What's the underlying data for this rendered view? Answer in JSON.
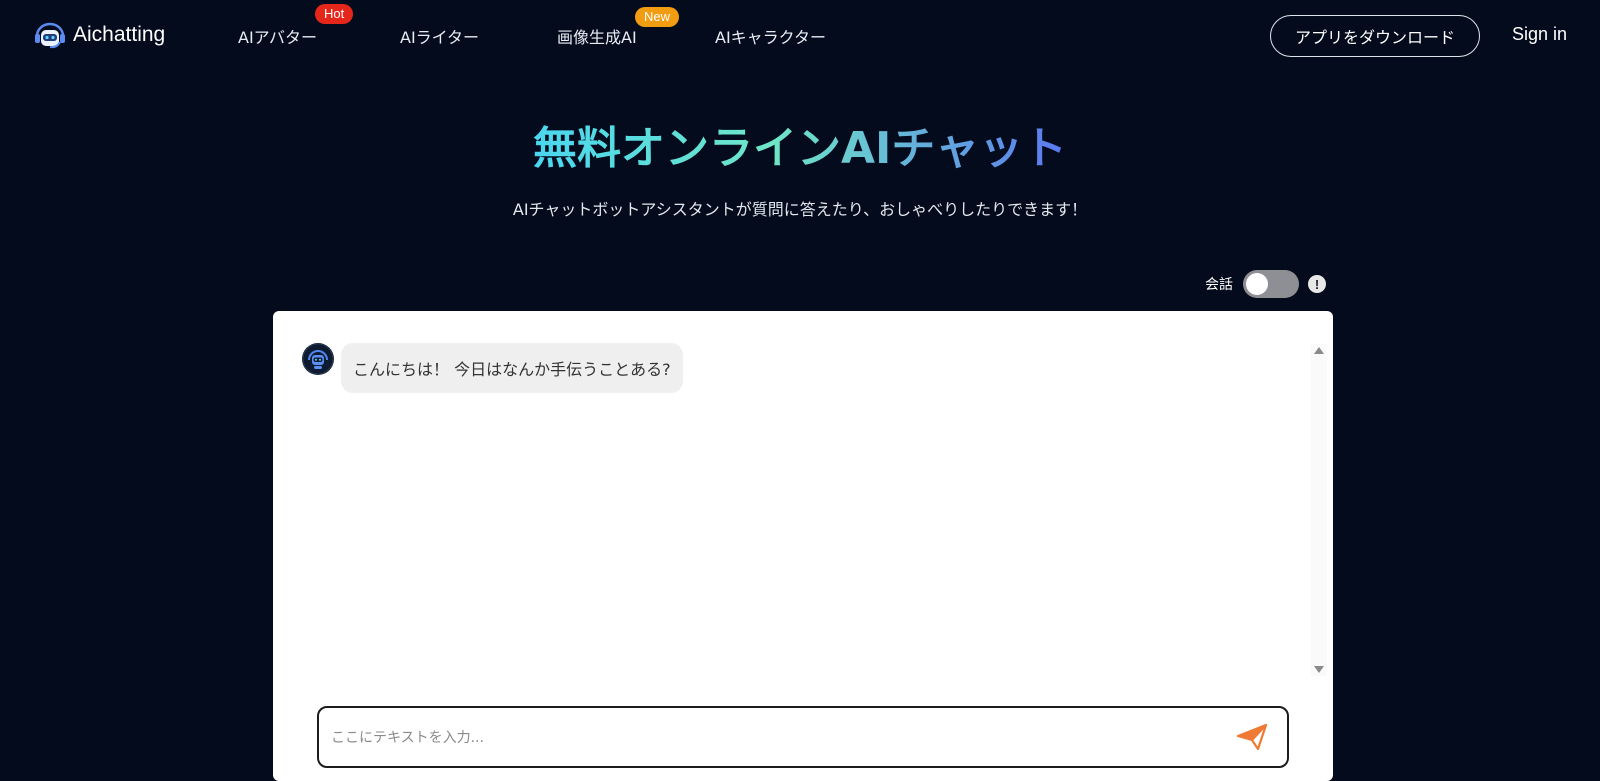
{
  "header": {
    "logo_text": "Aichatting",
    "nav": [
      {
        "label": "AIアバター",
        "badge": "Hot"
      },
      {
        "label": "AIライター"
      },
      {
        "label": "画像生成AI",
        "badge": "New"
      },
      {
        "label": "AIキャラクター"
      }
    ],
    "download_label": "アプリをダウンロード",
    "signin_label": "Sign in"
  },
  "hero": {
    "title": "無料オンラインAIチャット",
    "subtitle": "AIチャットボットアシスタントが質問に答えたり、おしゃべりしたりできます！"
  },
  "conversation_toggle": {
    "label": "会話",
    "enabled": false,
    "info_glyph": "!"
  },
  "chat": {
    "messages": [
      {
        "sender": "bot",
        "text": "こんにちは！ 今日はなんか手伝うことある?"
      }
    ],
    "input_placeholder": "ここにテキストを入力...",
    "input_value": ""
  },
  "icons": {
    "logo": "robot-headset-icon",
    "avatar": "bot-avatar-icon",
    "send": "paper-plane-icon",
    "info": "info-icon"
  },
  "colors": {
    "background": "#040b1c",
    "hot_badge": "#e5261b",
    "new_badge": "#f29c11",
    "send_icon": "#f07a34"
  }
}
